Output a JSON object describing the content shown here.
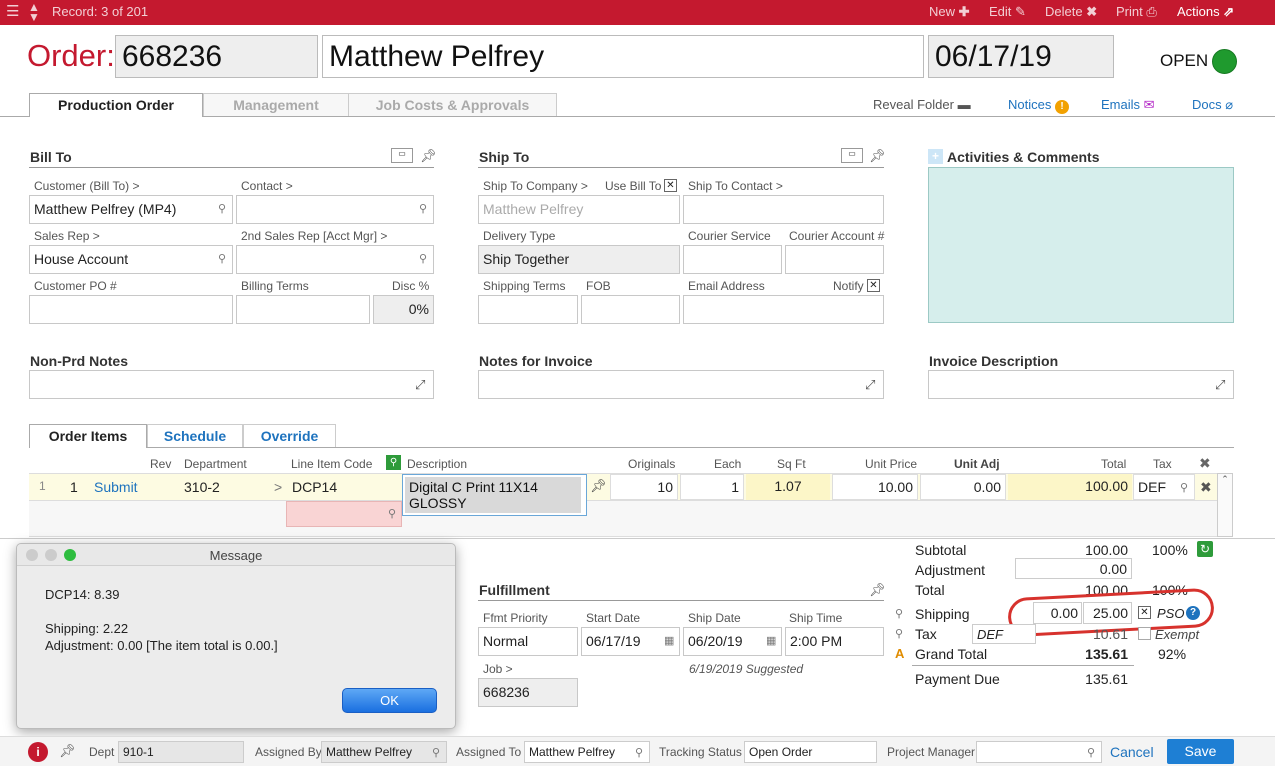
{
  "topbar": {
    "record": "Record: 3 of 201",
    "new": "New",
    "edit": "Edit",
    "delete": "Delete",
    "print": "Print",
    "actions": "Actions"
  },
  "header": {
    "order_label": "Order:",
    "order_no": "668236",
    "customer": "Matthew Pelfrey",
    "date": "06/17/19",
    "status": "OPEN",
    "status_color": "#1f9a2e"
  },
  "tabs": [
    "Production Order",
    "Management",
    "Job Costs & Approvals"
  ],
  "toplinks": {
    "reveal": "Reveal Folder",
    "notices": "Notices",
    "emails": "Emails",
    "docs": "Docs"
  },
  "billto": {
    "title": "Bill To",
    "customer_label": "Customer (Bill To) >",
    "customer": "Matthew Pelfrey  (MP4)",
    "contact_label": "Contact >",
    "salesrep_label": "Sales Rep >",
    "salesrep": "House Account",
    "rep2_label": "2nd Sales Rep [Acct Mgr] >",
    "po_label": "Customer PO #",
    "terms_label": "Billing Terms",
    "disc_label": "Disc %",
    "disc": "0%"
  },
  "shipto": {
    "title": "Ship To",
    "company_label": "Ship To Company >",
    "usebill_label": "Use Bill To",
    "contact_label": "Ship To Contact >",
    "company_placeholder": "Matthew Pelfrey",
    "delivery_label": "Delivery Type",
    "delivery": "Ship Together",
    "courier_label": "Courier Service",
    "courier_acct_label": "Courier Account #",
    "terms_label": "Shipping Terms",
    "fob_label": "FOB",
    "email_label": "Email Address",
    "notify_label": "Notify"
  },
  "activities": {
    "title": "Activities & Comments"
  },
  "notes": {
    "nonprd": "Non-Prd Notes",
    "invoice_notes": "Notes for Invoice",
    "invoice_desc": "Invoice Description"
  },
  "itemtabs": [
    "Order Items",
    "Schedule",
    "Override"
  ],
  "items": {
    "headers": {
      "rev": "Rev",
      "dept": "Department",
      "code": "Line Item Code",
      "desc": "Description",
      "orig": "Originals",
      "each": "Each",
      "sqft": "Sq Ft",
      "price": "Unit Price",
      "adj": "Unit Adj",
      "total": "Total",
      "tax": "Tax"
    },
    "row": {
      "num": "1",
      "rev": "1",
      "action": "Submit",
      "dept": "310-2",
      "code": "DCP14",
      "desc": "Digital C Print 11X14 GLOSSY",
      "orig": "10",
      "each": "1",
      "sqft": "1.07",
      "price": "10.00",
      "adj": "0.00",
      "total": "100.00",
      "tax": "DEF"
    }
  },
  "totals": {
    "subtotal_label": "Subtotal",
    "subtotal": "100.00",
    "subtotal_pct": "100%",
    "adj_label": "Adjustment",
    "adj": "0.00",
    "total_label": "Total",
    "total": "100.00",
    "total_pct": "100%",
    "ship_label": "Shipping",
    "ship1": "0.00",
    "ship2": "25.00",
    "pso": "PSO",
    "tax_label": "Tax",
    "tax_code": "DEF",
    "tax_val": "10.61",
    "exempt": "Exempt",
    "grand_label": "Grand Total",
    "grand": "135.61",
    "grand_pct": "92%",
    "due_label": "Payment Due",
    "due": "135.61"
  },
  "fulfillment": {
    "title": "Fulfillment",
    "priority_label": "Ffmt Priority",
    "priority": "Normal",
    "start_label": "Start Date",
    "start": "06/17/19",
    "shipdate_label": "Ship Date",
    "shipdate": "06/20/19",
    "shiptime_label": "Ship Time",
    "shiptime": "2:00 PM",
    "suggested": "6/19/2019 Suggested",
    "job_label": "Job >",
    "job": "668236"
  },
  "dialog": {
    "title": "Message",
    "line1": "DCP14: 8.39",
    "line2": "Shipping: 2.22",
    "line3": "Adjustment: 0.00 [The item total is 0.00.]",
    "ok": "OK"
  },
  "bottom": {
    "dept_label": "Dept",
    "dept": "910-1",
    "assignedby_label": "Assigned By",
    "assignedby": "Matthew Pelfrey",
    "assignedto_label": "Assigned To",
    "assignedto": "Matthew Pelfrey",
    "tracking_label": "Tracking Status",
    "tracking": "Open Order",
    "pm_label": "Project Manager",
    "cancel": "Cancel",
    "save": "Save"
  }
}
